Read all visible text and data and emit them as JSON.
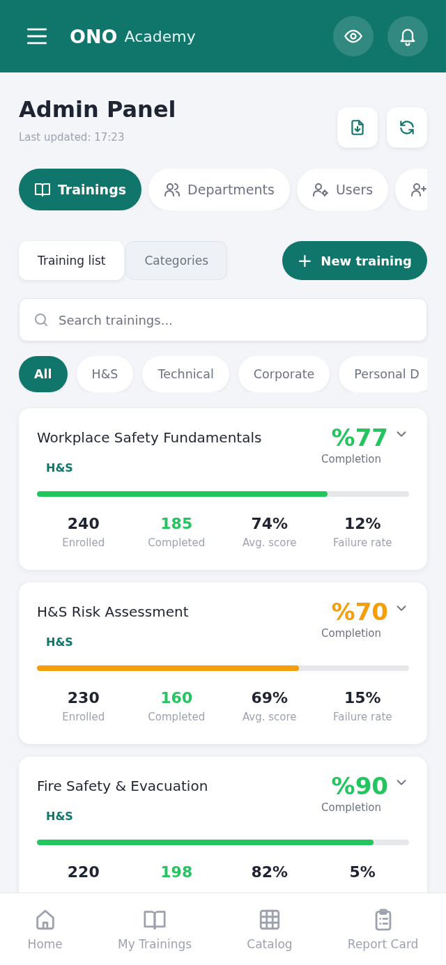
{
  "header": {
    "brand": "ONO",
    "subtitle": "Academy"
  },
  "page": {
    "title": "Admin Panel",
    "updated": "Last updated: 17:23"
  },
  "tabs": [
    {
      "label": "Trainings",
      "selected": true
    },
    {
      "label": "Departments",
      "selected": false
    },
    {
      "label": "Users",
      "selected": false
    },
    {
      "selected": false
    }
  ],
  "subtabs": [
    {
      "label": "Training list",
      "selected": true
    },
    {
      "label": "Categories",
      "selected": false
    }
  ],
  "new_button": {
    "icon": "+",
    "label": "New training"
  },
  "search": {
    "placeholder": "Search trainings..."
  },
  "filters": [
    {
      "label": "All",
      "selected": true
    },
    {
      "label": "H&S",
      "selected": false
    },
    {
      "label": "Technical",
      "selected": false
    },
    {
      "label": "Corporate",
      "selected": false
    },
    {
      "label": "Personal D",
      "selected": false
    }
  ],
  "trainings": [
    {
      "title": "Workplace Safety Fundamentals",
      "category": "H&S",
      "completion": "%77",
      "completion_label": "Completion",
      "color": "#22c55e",
      "level": 0.78,
      "stats": [
        {
          "value": "240",
          "label": "Enrolled"
        },
        {
          "value": "185",
          "label": "Completed"
        },
        {
          "value": "74%",
          "label": "Avg. score"
        },
        {
          "value": "12%",
          "label": "Failure rate"
        }
      ]
    },
    {
      "title": "H&S Risk Assessment",
      "category": "H&S",
      "completion": "%70",
      "completion_label": "Completion",
      "color": "#f59e0b",
      "level": 0.705,
      "stats": [
        {
          "value": "230",
          "label": "Enrolled"
        },
        {
          "value": "160",
          "label": "Completed"
        },
        {
          "value": "69%",
          "label": "Avg. score"
        },
        {
          "value": "15%",
          "label": "Failure rate"
        }
      ]
    },
    {
      "title": "Fire Safety & Evacuation",
      "category": "H&S",
      "completion": "%90",
      "completion_label": "Completion",
      "color": "#22c55e",
      "level": 0.905,
      "stats": [
        {
          "value": "220"
        },
        {
          "value": "198"
        },
        {
          "value": "82%"
        },
        {
          "value": "5%"
        }
      ]
    }
  ],
  "bottom_nav": [
    {
      "label": "Home",
      "selected": false
    },
    {
      "label": "My Trainings",
      "selected": false
    },
    {
      "label": "Catalog",
      "selected": false
    },
    {
      "label": "Report Card",
      "selected": false
    }
  ]
}
